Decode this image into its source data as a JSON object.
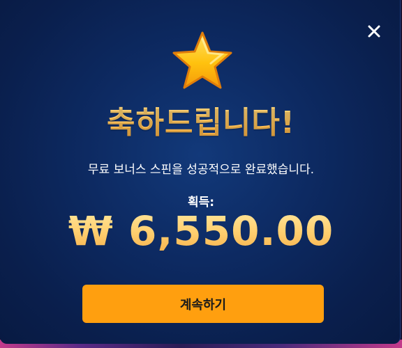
{
  "modal": {
    "title": "축하드립니다!",
    "message": "무료 보너스 스핀을 성공적으로 완료했습니다.",
    "earned_label": "획득:",
    "amount": "₩ 6,550.00",
    "continue_label": "계속하기",
    "close_icon": "close-icon",
    "star_icon": "star-icon"
  },
  "colors": {
    "background": "#0d2a62",
    "accent": "#ff9f0f",
    "title_gold": "#ffc65a",
    "text": "#ffffff"
  }
}
